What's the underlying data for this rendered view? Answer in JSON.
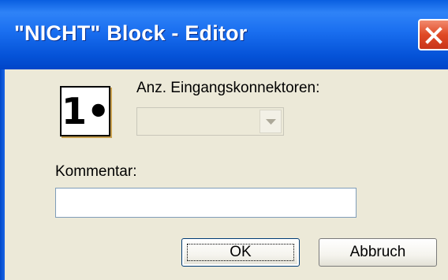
{
  "window": {
    "title": "\"NICHT\" Block - Editor"
  },
  "icons": {
    "close": "close-icon",
    "block": "not-block-icon",
    "dropdown": "chevron-down-icon"
  },
  "block_icon_text": "1•",
  "inputs_label": "Anz. Eingangskonnektoren:",
  "inputs_select": {
    "value": "",
    "disabled": true
  },
  "comment_label": "Kommentar:",
  "comment_value": "",
  "buttons": {
    "ok": "OK",
    "cancel": "Abbruch"
  },
  "colors": {
    "titlebar": "#0a5fe0",
    "close": "#e04a25",
    "dialog_bg": "#ece9d8"
  }
}
